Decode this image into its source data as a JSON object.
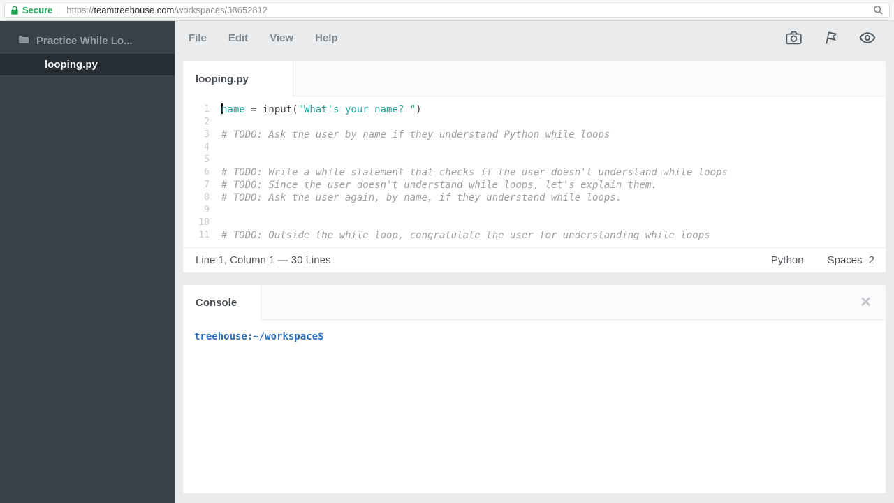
{
  "browser": {
    "secure_label": "Secure",
    "url_scheme": "https://",
    "url_domain": "teamtreehouse.com",
    "url_path": "/workspaces/38652812"
  },
  "sidebar": {
    "workspace_name": "Practice While Lo...",
    "files": [
      {
        "name": "looping.py"
      }
    ]
  },
  "menu": {
    "items": [
      {
        "label": "File"
      },
      {
        "label": "Edit"
      },
      {
        "label": "View"
      },
      {
        "label": "Help"
      }
    ]
  },
  "editor": {
    "tab_label": "looping.py",
    "status": {
      "position": "Line 1, Column 1 — 30 Lines",
      "language": "Python",
      "indent_label": "Spaces",
      "indent_value": "2"
    },
    "lines": [
      {
        "n": 1,
        "cursor": true,
        "segments": [
          {
            "text": "name",
            "type": "variable"
          },
          {
            "text": " = input(",
            "type": "plain"
          },
          {
            "text": "\"What's your name? \"",
            "type": "string"
          },
          {
            "text": ")",
            "type": "plain"
          }
        ]
      },
      {
        "n": 2,
        "segments": []
      },
      {
        "n": 3,
        "segments": [
          {
            "text": "# TODO: Ask the user by name if they understand Python while loops",
            "type": "comment"
          }
        ]
      },
      {
        "n": 4,
        "segments": []
      },
      {
        "n": 5,
        "segments": []
      },
      {
        "n": 6,
        "segments": [
          {
            "text": "# TODO: Write a while statement that checks if the user doesn't understand while loops",
            "type": "comment"
          }
        ]
      },
      {
        "n": 7,
        "segments": [
          {
            "text": "# TODO: Since the user doesn't understand while loops, let's explain them.",
            "type": "comment"
          }
        ]
      },
      {
        "n": 8,
        "segments": [
          {
            "text": "# TODO: Ask the user again, by name, if they understand while loops.",
            "type": "comment"
          }
        ]
      },
      {
        "n": 9,
        "segments": []
      },
      {
        "n": 10,
        "segments": []
      },
      {
        "n": 11,
        "segments": [
          {
            "text": "# TODO: Outside the while loop, congratulate the user for understanding while loops",
            "type": "comment"
          }
        ]
      }
    ]
  },
  "console": {
    "tab_label": "Console",
    "close_glyph": "✕",
    "prompt": {
      "user": "treehouse",
      "separator": ":",
      "path": "~/workspace",
      "symbol": "$"
    }
  },
  "colors": {
    "secure_green": "#23a455",
    "sidebar_bg": "#3a4147",
    "accent_teal": "#26a59e",
    "comment_gray": "#9ba0a4",
    "prompt_blue": "#2a6db4"
  }
}
